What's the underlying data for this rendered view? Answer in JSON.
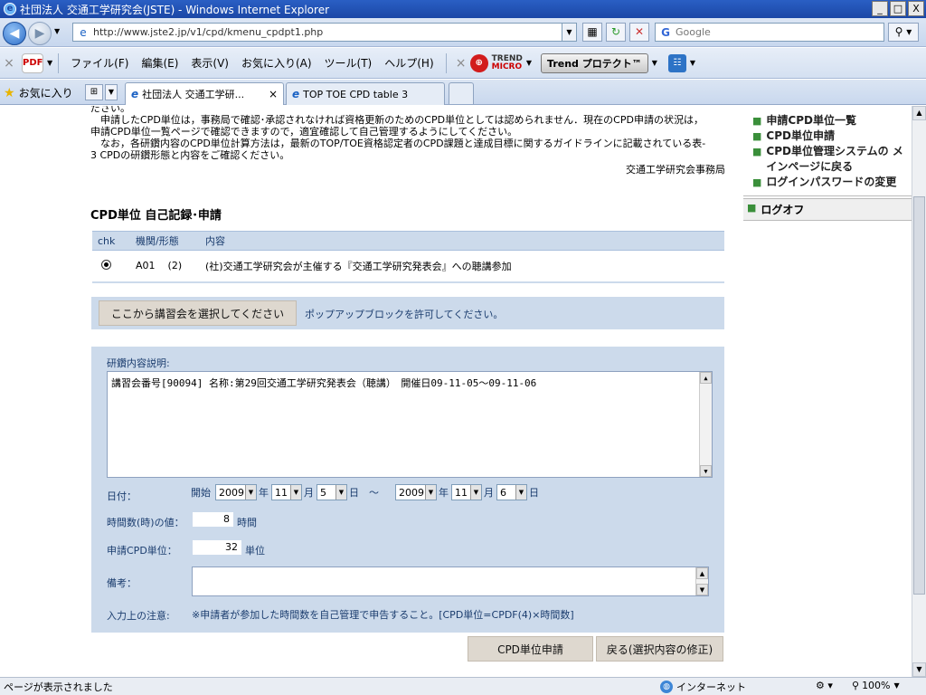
{
  "window": {
    "title": "社団法人 交通工学研究会(JSTE) - Windows Internet Explorer",
    "minimize": "_",
    "maximize": "□",
    "close": "X"
  },
  "address": {
    "url": "http://www.jste2.jp/v1/cpd/kmenu_cpdpt1.php",
    "search_placeholder": "Google"
  },
  "menu": {
    "items": [
      "ファイル(F)",
      "編集(E)",
      "表示(V)",
      "お気に入り(A)",
      "ツール(T)",
      "ヘルプ(H)"
    ],
    "trend_label_1": "TREND",
    "trend_label_2": "MICRO",
    "trend_protect": "Trend プロテクト™"
  },
  "tabs": {
    "favorites": "お気に入り",
    "items": [
      {
        "label": "社団法人 交通工学研...",
        "active": true
      },
      {
        "label": "TOP TOE CPD table 3",
        "active": false
      }
    ]
  },
  "notice": {
    "line0": "ださい。",
    "line1": "　申請したCPD単位は，事務局で確認･承認されなければ資格更新のためのCPD単位としては認められません．現在のCPD申請の状況は，",
    "line2": "申請CPD単位一覧ページで確認できますので，適宜確認して自己管理するようにしてください。",
    "line3": "　なお，各研鑽内容のCPD単位計算方法は，最新のTOP/TOE資格認定者のCPD課題と達成目標に関するガイドラインに記載されている表-",
    "line4": "3 CPDの研鑽形態と内容をご確認ください。",
    "office": "交通工学研究会事務局"
  },
  "sidebar": {
    "links": [
      "申請CPD単位一覧",
      "CPD単位申請",
      "CPD単位管理システムの メインページに戻る",
      "ログインパスワードの変更"
    ],
    "logout": "ログオフ"
  },
  "section": {
    "title": "CPD単位 自己記録･申請"
  },
  "table": {
    "headers": [
      "chk",
      "機関/形態",
      "内容"
    ],
    "row": {
      "code": "A01",
      "type": "(2)",
      "content": "(社)交通工学研究会が主催する『交通工学研究発表会』への聴講参加"
    }
  },
  "select_bar": {
    "button": "ここから講習会を選択してください",
    "popup_note": "ポップアップブロックを許可してください。"
  },
  "form": {
    "desc_label": "研鑽内容説明:",
    "desc_value": "講習会番号[90094] 名称:第29回交通工学研究発表会（聴講）　開催日09-11-05～09-11-06",
    "date_label": "日付：",
    "start_label": "開始",
    "start_year": "2009",
    "start_month": "11",
    "start_day": "5",
    "end_year": "2009",
    "end_month": "11",
    "end_day": "6",
    "year_unit": "年",
    "month_unit": "月",
    "day_unit": "日",
    "tilde": "～",
    "hours_label": "時間数(時)の値：",
    "hours_value": "8",
    "hours_unit": "時間",
    "cpd_label": "申請CPD単位：",
    "cpd_value": "32",
    "cpd_unit": "単位",
    "memo_label": "備考：",
    "note_label": "入力上の注意:",
    "note_text": "※申請者が参加した時間数を自己管理で申告すること。[CPD単位=CPDF(4)×時間数]"
  },
  "buttons": {
    "submit": "CPD単位申請",
    "back": "戻る(選択内容の修正)"
  },
  "status": {
    "text": "ページが表示されました",
    "zone": "インターネット",
    "zoom": "100%"
  }
}
